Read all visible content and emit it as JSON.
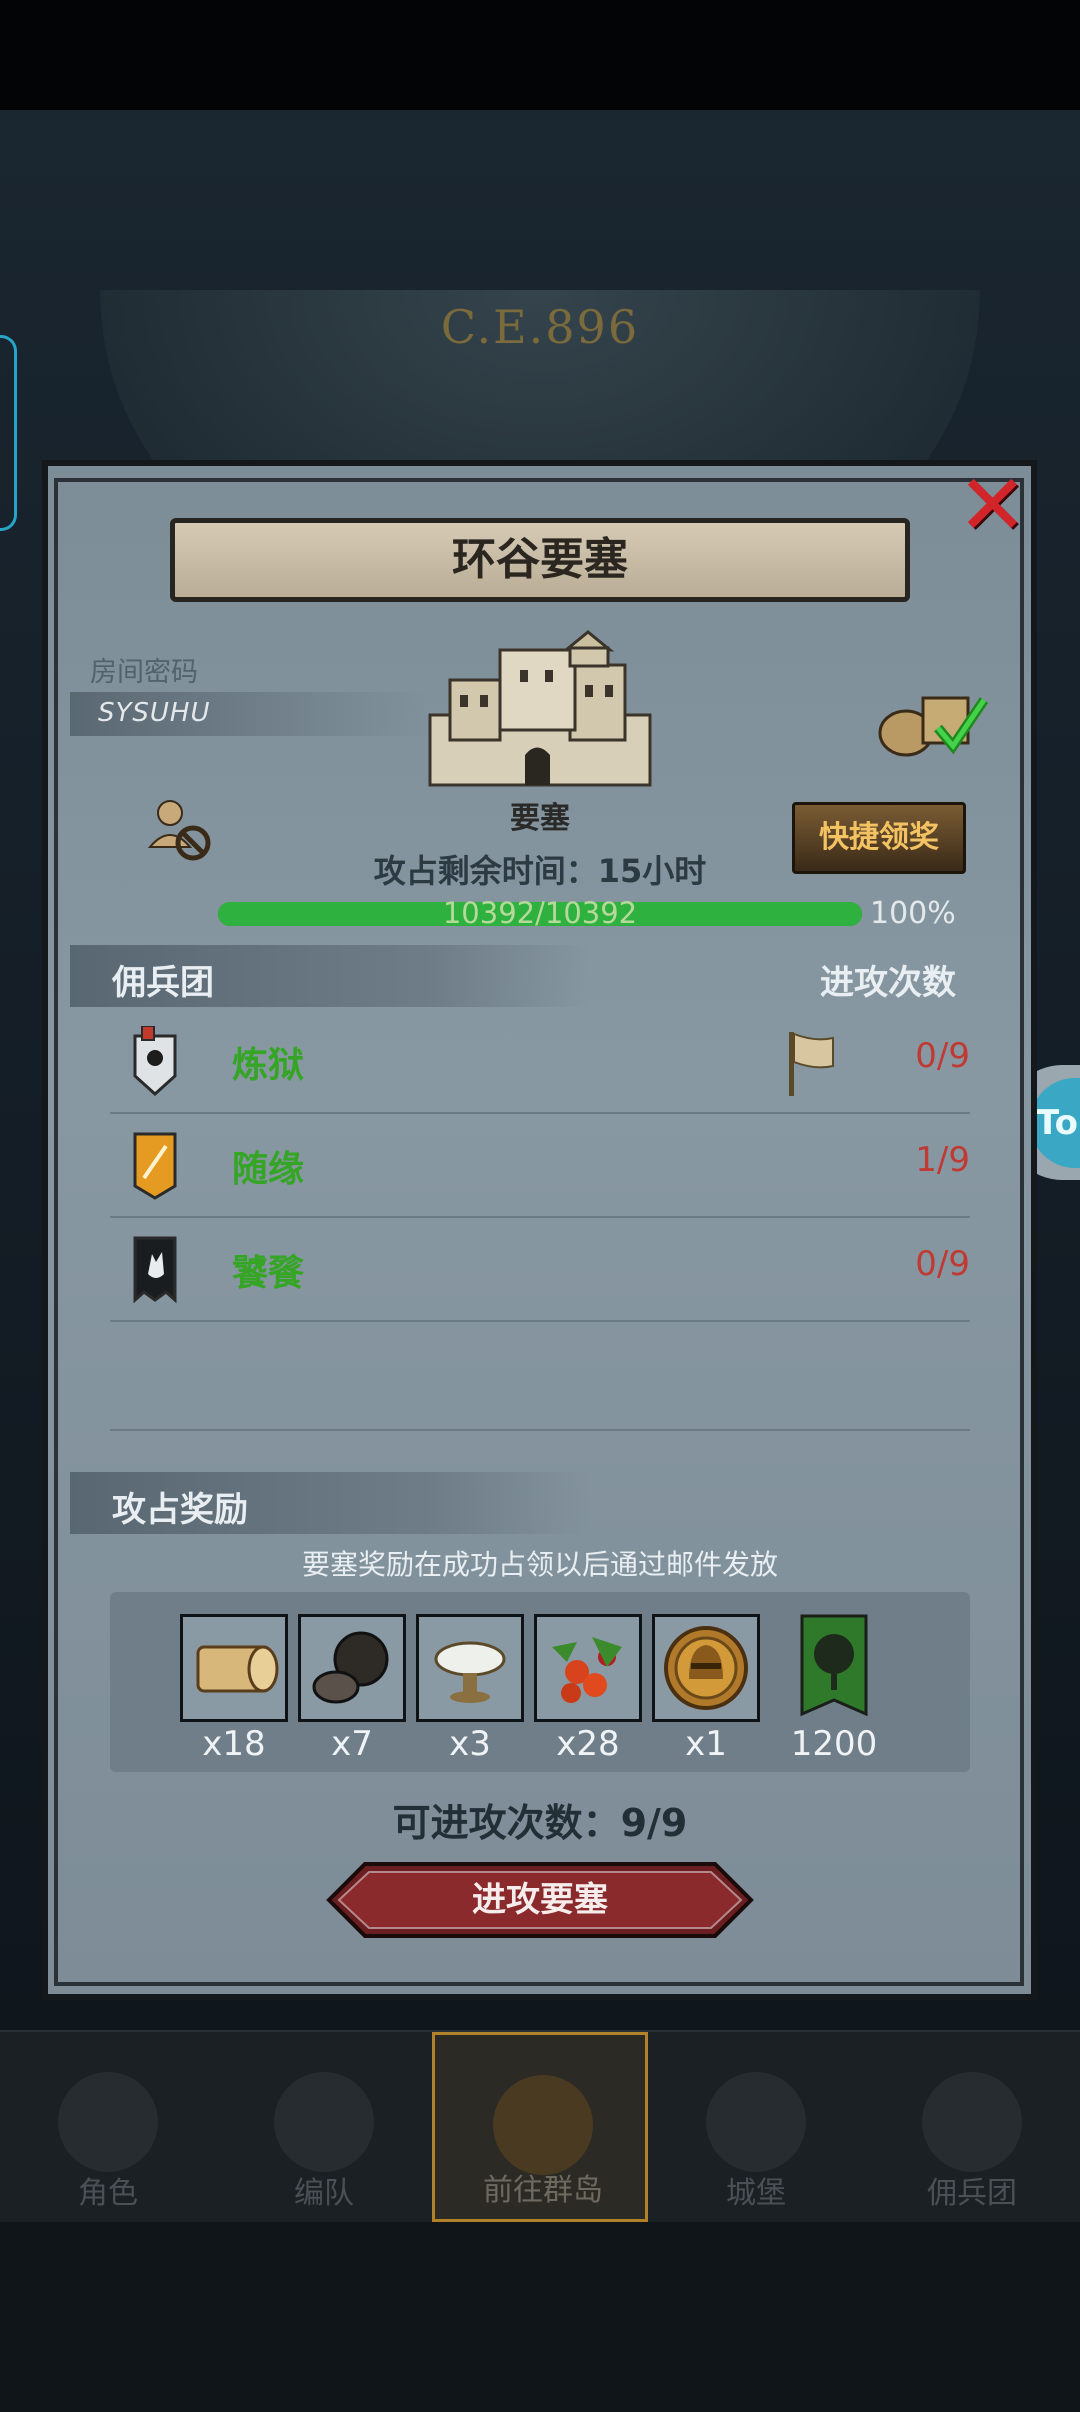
{
  "era": "C.E.896",
  "side_button": "To",
  "dialog": {
    "title": "环谷要塞",
    "room_password_label": "房间密码",
    "room_password": "SYSUHU",
    "building_type": "要塞",
    "quick_claim": "快捷领奖",
    "time_remaining": "攻占剩余时间：15小时",
    "progress_text": "10392/10392",
    "progress_percent": "100%",
    "progress_value": 1.0,
    "mercenary_header": "佣兵团",
    "attack_count_header": "进攻次数",
    "guilds": [
      {
        "name": "炼狱",
        "attacks": "0/9",
        "emblem": "sun-shield-emblem-icon"
      },
      {
        "name": "随缘",
        "attacks": "1/9",
        "emblem": "sword-banner-emblem-icon"
      },
      {
        "name": "饕餮",
        "attacks": "0/9",
        "emblem": "wolf-banner-emblem-icon"
      }
    ],
    "reward_header": "攻占奖励",
    "reward_note": "要塞奖励在成功占领以后通过邮件发放",
    "rewards": [
      {
        "icon": "wood-log-icon",
        "qty": "x18"
      },
      {
        "icon": "ore-rock-icon",
        "qty": "x7"
      },
      {
        "icon": "silver-dish-icon",
        "qty": "x3"
      },
      {
        "icon": "berries-icon",
        "qty": "x28"
      },
      {
        "icon": "gold-helmet-coin-icon",
        "qty": "x1"
      },
      {
        "icon": "green-tree-banner-icon",
        "qty": "1200"
      }
    ],
    "attacks_available": "可进攻次数：9/9",
    "attack_button": "进攻要塞"
  },
  "bottom_nav": [
    {
      "label": "角色",
      "icon": "character-icon"
    },
    {
      "label": "编队",
      "icon": "formation-icon"
    },
    {
      "label": "前往群岛",
      "icon": "islands-icon",
      "active": true
    },
    {
      "label": "城堡",
      "icon": "castle-icon"
    },
    {
      "label": "佣兵团",
      "icon": "mercenary-icon"
    }
  ],
  "colors": {
    "progress": "#2fb13f",
    "guild_name": "#34a524",
    "attack_count": "#c03a34",
    "close": "#d2252a",
    "nav_active_border": "#b2822a"
  }
}
